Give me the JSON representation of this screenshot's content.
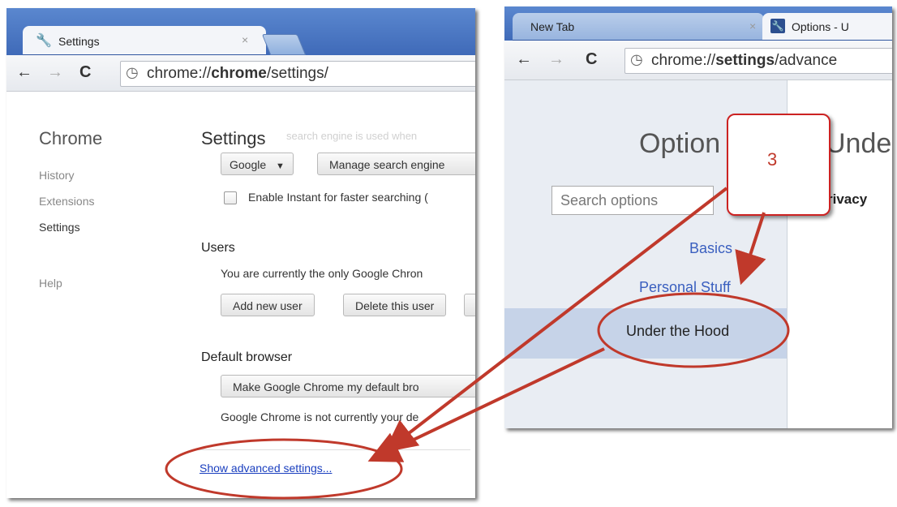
{
  "left_window": {
    "tab_title": "Settings",
    "tab_close": "×",
    "nav": {
      "back": "←",
      "forward": "→",
      "reload": "C"
    },
    "url_prefix": "chrome://",
    "url_bold": "chrome",
    "url_suffix": "/settings/",
    "sidebar": {
      "heading": "Chrome",
      "items": [
        "History",
        "Extensions",
        "Settings",
        "Help"
      ]
    },
    "page_title": "Settings",
    "faded_text": "search engine is used when",
    "search_engine": {
      "dropdown_value": "Google",
      "manage_button": "Manage search engine"
    },
    "instant_checkbox_label": "Enable Instant for faster searching (",
    "users": {
      "heading": "Users",
      "description": "You are currently the only Google Chron",
      "add_button": "Add new user",
      "delete_button": "Delete this user"
    },
    "default_browser": {
      "heading": "Default browser",
      "make_default_button": "Make Google Chrome my default bro",
      "status": "Google Chrome is not currently your de"
    },
    "advanced_link": "Show advanced settings..."
  },
  "right_window": {
    "tab1": "New Tab",
    "tab1_close": "×",
    "tab2": "Options - U",
    "nav": {
      "back": "←",
      "forward": "→",
      "reload": "C"
    },
    "url_prefix": "chrome://",
    "url_bold": "settings",
    "url_suffix": "/advance",
    "big_title": "Option",
    "big_title_right": "Unde",
    "search_placeholder": "Search options",
    "nav_items": [
      "Basics",
      "Personal Stuff",
      "Under the Hood"
    ],
    "privacy_heading": "rivacy"
  },
  "callout": {
    "label": "3"
  },
  "colors": {
    "annotation_red": "#c0392b",
    "link_blue": "#1a3fbf",
    "tab_blue": "#4a78c4"
  }
}
